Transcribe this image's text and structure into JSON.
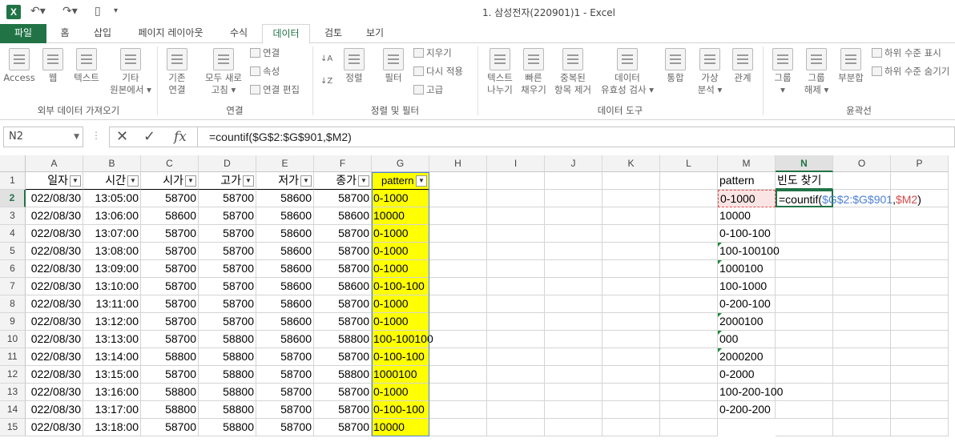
{
  "app": {
    "logo": "X",
    "title": "1. 삼성전자(220901)1 - Excel"
  },
  "tabs": [
    "파일",
    "홈",
    "삽입",
    "페이지 레이아웃",
    "수식",
    "데이터",
    "검토",
    "보기"
  ],
  "ribbon": {
    "ext": {
      "access": "Access",
      "web": "웹",
      "text": "텍스트",
      "other1": "기타",
      "other2": "원본에서 ▾",
      "group": "외부 데이터 가져오기"
    },
    "conn": {
      "existing1": "기존",
      "existing2": "연결",
      "refresh1": "모두 새로",
      "refresh2": "고침 ▾",
      "c1": "연결",
      "c2": "속성",
      "c3": "연결 편집",
      "group": "연결"
    },
    "sort": {
      "sort": "정렬",
      "filter": "필터",
      "clear": "지우기",
      "reapply": "다시 적용",
      "adv": "고급",
      "group": "정렬 및 필터"
    },
    "tools": {
      "ttc1": "텍스트",
      "ttc2": "나누기",
      "flash1": "빠른",
      "flash2": "채우기",
      "dup1": "중복된",
      "dup2": "항목 제거",
      "val1": "데이터",
      "val2": "유효성 검사 ▾",
      "cons": "통합",
      "whatif1": "가상",
      "whatif2": "분석 ▾",
      "rel": "관계",
      "group": "데이터 도구"
    },
    "outline": {
      "grp1": "그룹",
      "grp2": "▾",
      "ungrp1": "그룹",
      "ungrp2": "해제 ▾",
      "sub": "부분합",
      "show": "하위 수준 표시",
      "hide": "하위 수준 숨기기",
      "group": "윤곽선"
    }
  },
  "formula_bar": {
    "namebox": "N2",
    "formula": "=countif($G$2:$G$901,$M2)"
  },
  "columns": [
    "A",
    "B",
    "C",
    "D",
    "E",
    "F",
    "G",
    "H",
    "I",
    "J",
    "K",
    "L",
    "M",
    "N",
    "O",
    "P"
  ],
  "rows": [
    "1",
    "2",
    "3",
    "4",
    "5",
    "6",
    "7",
    "8",
    "9",
    "10",
    "11",
    "12",
    "13",
    "14",
    "15"
  ],
  "headers": {
    "a": "일자",
    "b": "시간",
    "c": "시가",
    "d": "고가",
    "e": "저가",
    "f": "종가",
    "g": "pattern",
    "m": "pattern",
    "n": "빈도 찾기"
  },
  "data": [
    [
      "022/08/30",
      "13:05:00",
      "58700",
      "58700",
      "58600",
      "58700",
      "0-1000"
    ],
    [
      "022/08/30",
      "13:06:00",
      "58600",
      "58700",
      "58600",
      "58600",
      "10000"
    ],
    [
      "022/08/30",
      "13:07:00",
      "58700",
      "58700",
      "58600",
      "58700",
      "0-1000"
    ],
    [
      "022/08/30",
      "13:08:00",
      "58700",
      "58700",
      "58600",
      "58700",
      "0-1000"
    ],
    [
      "022/08/30",
      "13:09:00",
      "58700",
      "58700",
      "58600",
      "58700",
      "0-1000"
    ],
    [
      "022/08/30",
      "13:10:00",
      "58700",
      "58700",
      "58600",
      "58600",
      "0-100-100"
    ],
    [
      "022/08/30",
      "13:11:00",
      "58700",
      "58700",
      "58600",
      "58700",
      "0-1000"
    ],
    [
      "022/08/30",
      "13:12:00",
      "58700",
      "58700",
      "58600",
      "58700",
      "0-1000"
    ],
    [
      "022/08/30",
      "13:13:00",
      "58700",
      "58800",
      "58600",
      "58800",
      "100-100100"
    ],
    [
      "022/08/30",
      "13:14:00",
      "58800",
      "58800",
      "58700",
      "58700",
      "0-100-100"
    ],
    [
      "022/08/30",
      "13:15:00",
      "58700",
      "58800",
      "58700",
      "58800",
      "1000100"
    ],
    [
      "022/08/30",
      "13:16:00",
      "58800",
      "58800",
      "58700",
      "58700",
      "0-1000"
    ],
    [
      "022/08/30",
      "13:17:00",
      "58800",
      "58800",
      "58700",
      "58700",
      "0-100-100"
    ],
    [
      "022/08/30",
      "13:18:00",
      "58700",
      "58800",
      "58700",
      "58700",
      "10000"
    ]
  ],
  "m_col": [
    "0-1000",
    "10000",
    "0-100-100",
    "100-100100",
    "1000100",
    "100-1000",
    "0-200-100",
    "2000100",
    "000",
    "2000200",
    "0-2000",
    "100-200-100",
    "0-200-200"
  ],
  "m_tri": [
    false,
    false,
    false,
    true,
    true,
    false,
    false,
    true,
    true,
    true,
    false,
    false,
    false
  ],
  "n2": {
    "prefix": "=countif(",
    "ref1": "$G$2:$G$901",
    "comma": ",",
    "ref2": "$M2",
    "suffix": ")"
  }
}
